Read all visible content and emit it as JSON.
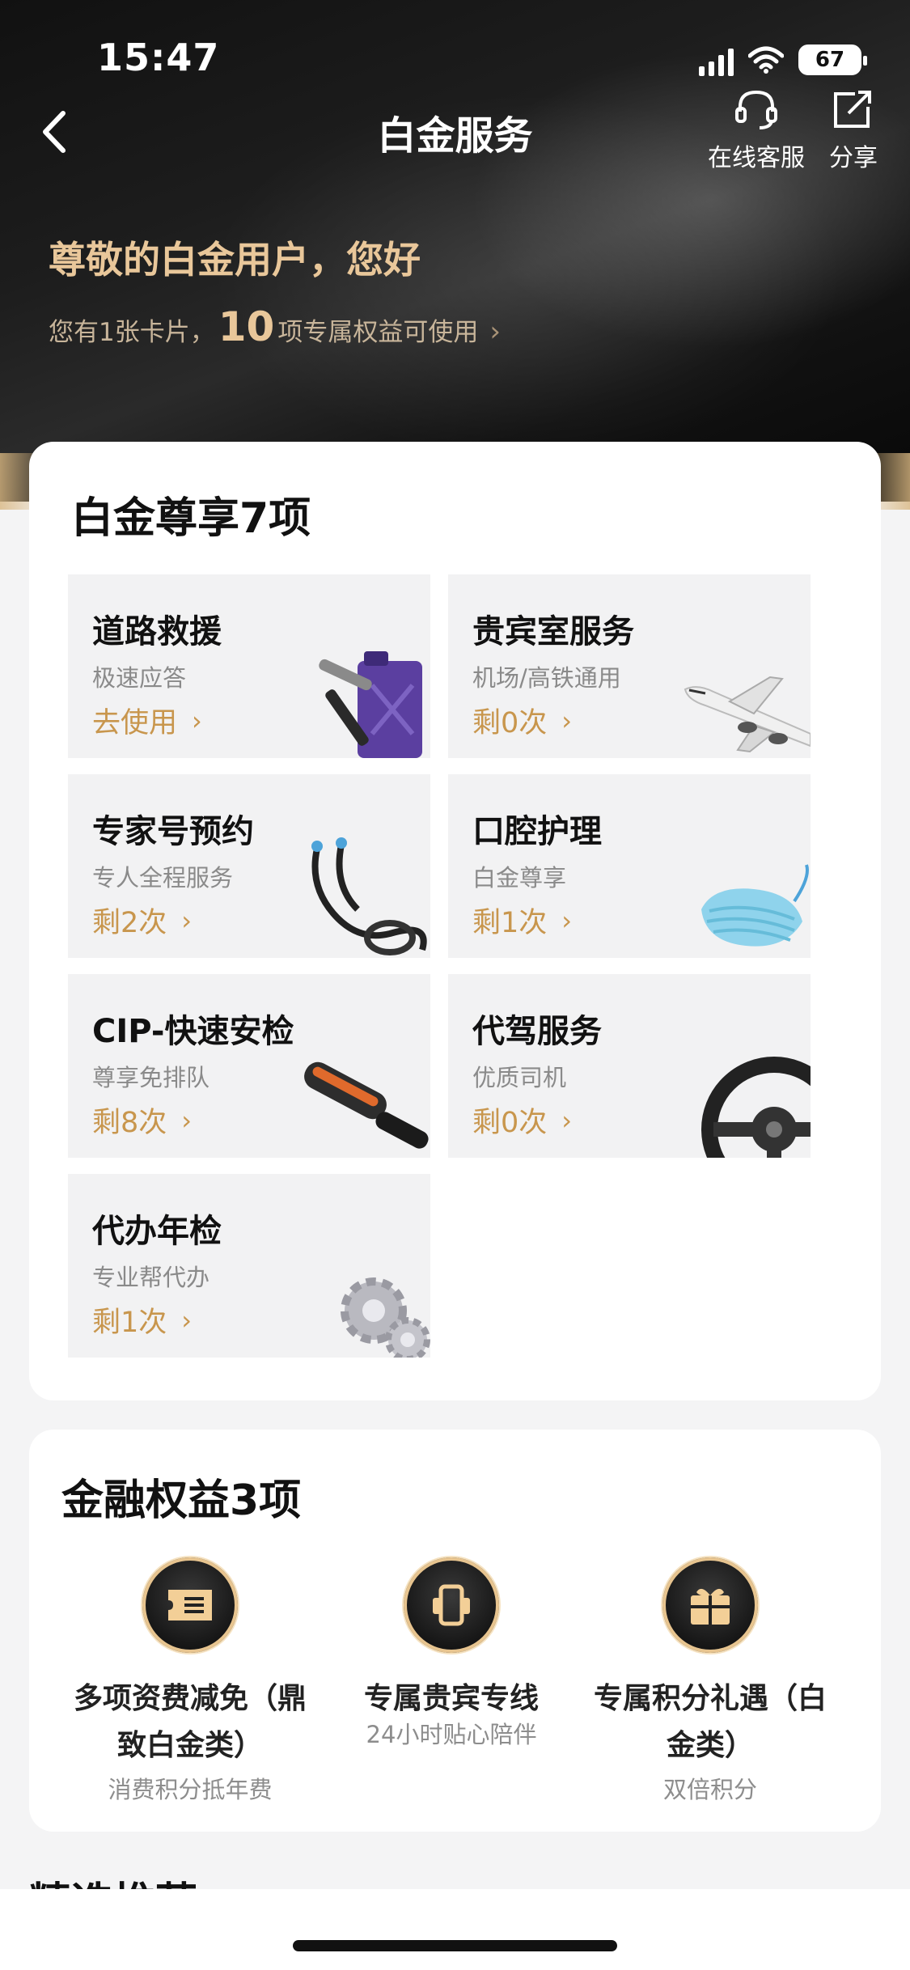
{
  "status": {
    "time": "15:47",
    "battery": "67"
  },
  "nav": {
    "title": "白金服务",
    "service_label": "在线客服",
    "share_label": "分享"
  },
  "hero": {
    "greeting": "尊敬的白金用户，您好",
    "summary_prefix": "您有1张卡片，",
    "summary_count": "10",
    "summary_suffix": "项专属权益可使用"
  },
  "platinum": {
    "title": "白金尊享7项",
    "items": [
      {
        "name": "道路救援",
        "desc": "极速应答",
        "action": "去使用",
        "icon": "fuel-can-hammer-icon"
      },
      {
        "name": "贵宾室服务",
        "desc": "机场/高铁通用",
        "action": "剩0次",
        "icon": "airplane-icon"
      },
      {
        "name": "专家号预约",
        "desc": "专人全程服务",
        "action": "剩2次",
        "icon": "stethoscope-icon"
      },
      {
        "name": "口腔护理",
        "desc": "白金尊享",
        "action": "剩1次",
        "icon": "mask-icon"
      },
      {
        "name": "CIP-快速安检",
        "desc": "尊享免排队",
        "action": "剩8次",
        "icon": "metal-detector-icon"
      },
      {
        "name": "代驾服务",
        "desc": "优质司机",
        "action": "剩0次",
        "icon": "steering-wheel-icon"
      },
      {
        "name": "代办年检",
        "desc": "专业帮代办",
        "action": "剩1次",
        "icon": "gears-icon"
      }
    ]
  },
  "finance": {
    "title": "金融权益3项",
    "items": [
      {
        "name_line1": "多项资费减免（鼎",
        "name_line2": "致白金类）",
        "desc": "消费积分抵年费",
        "icon": "ticket-icon"
      },
      {
        "name_line1": "专属贵宾专线",
        "name_line2": "",
        "desc": "24小时贴心陪伴",
        "icon": "phone-icon"
      },
      {
        "name_line1": "专属积分礼遇（白",
        "name_line2": "金类）",
        "desc": "双倍积分",
        "icon": "gift-icon"
      }
    ]
  },
  "more_title": "精选推荐",
  "colors": {
    "gold": "#c8964d",
    "gold_light": "#e9c79a",
    "bg": "#f4f4f5"
  }
}
